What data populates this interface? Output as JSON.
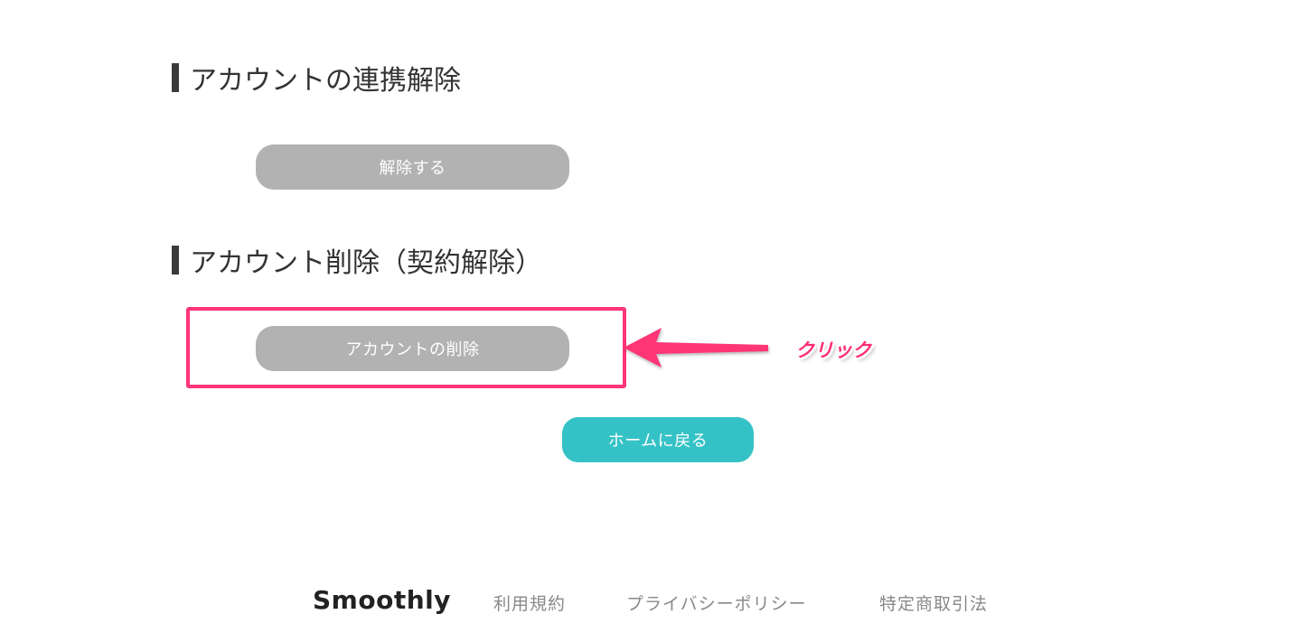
{
  "sections": {
    "unlink": {
      "heading": "アカウントの連携解除",
      "button_label": "解除する"
    },
    "delete": {
      "heading": "アカウント削除（契約解除）",
      "button_label": "アカウントの削除"
    }
  },
  "home_button_label": "ホームに戻る",
  "annotation": {
    "label": "クリック",
    "color": "#ff3476"
  },
  "footer": {
    "logo": "Smoothly",
    "links": [
      "利用規約",
      "プライバシーポリシー",
      "特定商取引法"
    ]
  },
  "colors": {
    "gray_button": "#b2b2b2",
    "teal_button": "#35c2c6",
    "highlight": "#ff3476"
  }
}
